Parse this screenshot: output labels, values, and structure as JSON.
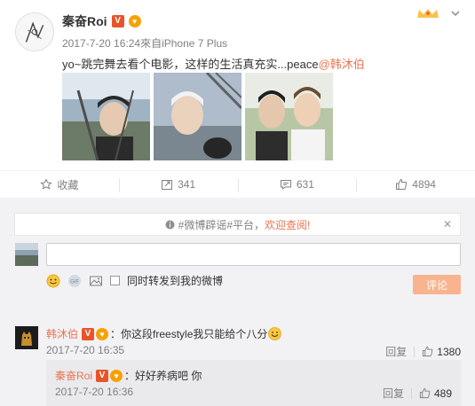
{
  "post": {
    "author": "秦奋Roi",
    "verified_badge": "V",
    "meta": "2017-7-20 16:24來自iPhone 7 Plus",
    "text": "yo~跳完舞去看个电影，这样的生活真充实...peace",
    "mention": "@韩沐伯",
    "photo_count": 3
  },
  "actions": {
    "favorite_label": "收藏",
    "repost_count": "341",
    "comment_count": "631",
    "like_count": "4894"
  },
  "notice": {
    "prefix": "#微博辟谣#平台，",
    "link": "欢迎查阅!",
    "close": "✕"
  },
  "composer": {
    "input_value": "",
    "also_repost_label": "同时转发到我的微博",
    "submit_label": "评论"
  },
  "comment": {
    "author": "韩沐伯",
    "text": "：你这段freestyle我只能给个八分",
    "time": "2017-7-20 16:35",
    "reply_label": "回复",
    "like_count": "1380"
  },
  "reply": {
    "author": "秦奋Roi",
    "text": "：好好养病吧 你",
    "time": "2017-7-20 16:36",
    "reply_label": "回复",
    "like_count": "489"
  },
  "colors": {
    "accent": "#eb7350",
    "muted": "#808080",
    "panel_bg": "#f2f2f5",
    "submit_bg": "#f7b48f"
  },
  "icons": [
    "crown-icon",
    "chevron-down-icon",
    "star-icon",
    "repost-icon",
    "comment-icon",
    "like-icon",
    "info-icon",
    "close-icon",
    "emoji-icon",
    "gif-icon",
    "image-icon"
  ]
}
